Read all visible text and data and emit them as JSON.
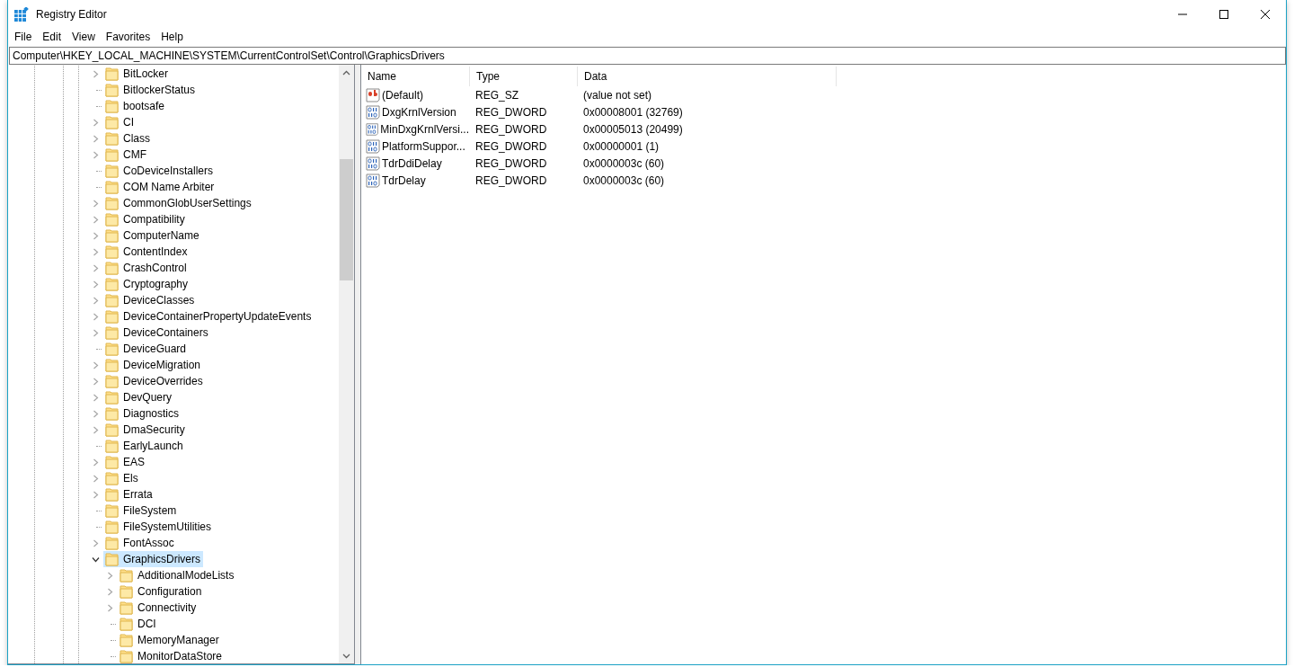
{
  "window": {
    "title": "Registry Editor"
  },
  "menu": [
    "File",
    "Edit",
    "View",
    "Favorites",
    "Help"
  ],
  "address": "Computer\\HKEY_LOCAL_MACHINE\\SYSTEM\\CurrentControlSet\\Control\\GraphicsDrivers",
  "tree": [
    {
      "label": "BitLocker",
      "expandable": true,
      "expanded": false,
      "selected": false
    },
    {
      "label": "BitlockerStatus",
      "expandable": false,
      "selected": false
    },
    {
      "label": "bootsafe",
      "expandable": false,
      "selected": false
    },
    {
      "label": "CI",
      "expandable": true,
      "expanded": false,
      "selected": false
    },
    {
      "label": "Class",
      "expandable": true,
      "expanded": false,
      "selected": false
    },
    {
      "label": "CMF",
      "expandable": true,
      "expanded": false,
      "selected": false
    },
    {
      "label": "CoDeviceInstallers",
      "expandable": false,
      "selected": false
    },
    {
      "label": "COM Name Arbiter",
      "expandable": false,
      "selected": false
    },
    {
      "label": "CommonGlobUserSettings",
      "expandable": true,
      "expanded": false,
      "selected": false
    },
    {
      "label": "Compatibility",
      "expandable": true,
      "expanded": false,
      "selected": false
    },
    {
      "label": "ComputerName",
      "expandable": true,
      "expanded": false,
      "selected": false
    },
    {
      "label": "ContentIndex",
      "expandable": true,
      "expanded": false,
      "selected": false
    },
    {
      "label": "CrashControl",
      "expandable": true,
      "expanded": false,
      "selected": false
    },
    {
      "label": "Cryptography",
      "expandable": true,
      "expanded": false,
      "selected": false
    },
    {
      "label": "DeviceClasses",
      "expandable": true,
      "expanded": false,
      "selected": false
    },
    {
      "label": "DeviceContainerPropertyUpdateEvents",
      "expandable": true,
      "expanded": false,
      "selected": false
    },
    {
      "label": "DeviceContainers",
      "expandable": true,
      "expanded": false,
      "selected": false
    },
    {
      "label": "DeviceGuard",
      "expandable": false,
      "selected": false
    },
    {
      "label": "DeviceMigration",
      "expandable": true,
      "expanded": false,
      "selected": false
    },
    {
      "label": "DeviceOverrides",
      "expandable": true,
      "expanded": false,
      "selected": false
    },
    {
      "label": "DevQuery",
      "expandable": true,
      "expanded": false,
      "selected": false
    },
    {
      "label": "Diagnostics",
      "expandable": true,
      "expanded": false,
      "selected": false
    },
    {
      "label": "DmaSecurity",
      "expandable": true,
      "expanded": false,
      "selected": false
    },
    {
      "label": "EarlyLaunch",
      "expandable": false,
      "selected": false
    },
    {
      "label": "EAS",
      "expandable": true,
      "expanded": false,
      "selected": false
    },
    {
      "label": "Els",
      "expandable": true,
      "expanded": false,
      "selected": false
    },
    {
      "label": "Errata",
      "expandable": true,
      "expanded": false,
      "selected": false
    },
    {
      "label": "FileSystem",
      "expandable": false,
      "selected": false
    },
    {
      "label": "FileSystemUtilities",
      "expandable": false,
      "selected": false
    },
    {
      "label": "FontAssoc",
      "expandable": true,
      "expanded": false,
      "selected": false
    },
    {
      "label": "GraphicsDrivers",
      "expandable": true,
      "expanded": true,
      "selected": true,
      "children": [
        {
          "label": "AdditionalModeLists",
          "expandable": true,
          "expanded": false,
          "selected": false
        },
        {
          "label": "Configuration",
          "expandable": true,
          "expanded": false,
          "selected": false
        },
        {
          "label": "Connectivity",
          "expandable": true,
          "expanded": false,
          "selected": false
        },
        {
          "label": "DCI",
          "expandable": false,
          "selected": false
        },
        {
          "label": "MemoryManager",
          "expandable": false,
          "selected": false
        },
        {
          "label": "MonitorDataStore",
          "expandable": false,
          "selected": false
        }
      ]
    }
  ],
  "values": {
    "columns": [
      "Name",
      "Type",
      "Data"
    ],
    "rows": [
      {
        "kind": "string",
        "name": "(Default)",
        "type": "REG_SZ",
        "data": "(value not set)"
      },
      {
        "kind": "dword",
        "name": "DxgKrnlVersion",
        "type": "REG_DWORD",
        "data": "0x00008001 (32769)"
      },
      {
        "kind": "dword",
        "name": "MinDxgKrnlVersi...",
        "type": "REG_DWORD",
        "data": "0x00005013 (20499)"
      },
      {
        "kind": "dword",
        "name": "PlatformSuppor...",
        "type": "REG_DWORD",
        "data": "0x00000001 (1)"
      },
      {
        "kind": "dword",
        "name": "TdrDdiDelay",
        "type": "REG_DWORD",
        "data": "0x0000003c (60)"
      },
      {
        "kind": "dword",
        "name": "TdrDelay",
        "type": "REG_DWORD",
        "data": "0x0000003c (60)"
      }
    ]
  }
}
